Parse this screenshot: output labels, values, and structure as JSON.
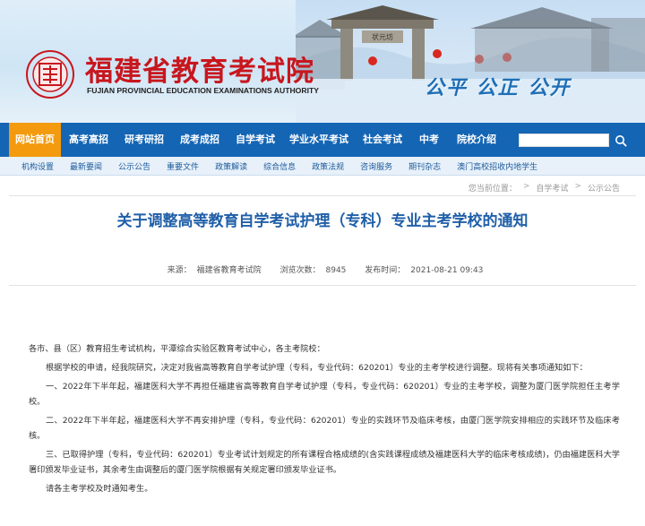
{
  "header": {
    "brand_cn": "福建省教育考试院",
    "brand_en": "FUJIAN PROVINCIAL EDUCATION EXAMINATIONS AUTHORITY",
    "slogan": "公平 公正 公开",
    "seal_text": "福建省教育考试院",
    "arch_plaque": "状元坊"
  },
  "nav": {
    "items": [
      "网站首页",
      "高考高招",
      "研考研招",
      "成考成招",
      "自学考试",
      "学业水平考试",
      "社会考试",
      "中考",
      "院校介绍"
    ],
    "active_index": 0,
    "search_placeholder": "",
    "search_icon": "search-icon"
  },
  "subnav": {
    "items": [
      "机构设置",
      "最新要闻",
      "公示公告",
      "重要文件",
      "政策解读",
      "综合信息",
      "政策法规",
      "咨询服务",
      "期刊杂志",
      "澳门高校招收内地学生"
    ]
  },
  "breadcrumb": {
    "prefix": "您当前位置：",
    "items": [
      "自学考试",
      "公示公告"
    ]
  },
  "article": {
    "title": "关于调整高等教育自学考试护理（专科）专业主考学校的通知",
    "source_label": "来源：",
    "source": "福建省教育考试院",
    "views_label": "浏览次数：",
    "views": "8945",
    "date_label": "发布时间：",
    "date": "2021-08-21 09:43",
    "paragraphs": [
      "各市、县（区）教育招生考试机构，平潭综合实验区教育考试中心，各主考院校：",
      "根据学校的申请，经我院研究，决定对我省高等教育自学考试护理（专科，专业代码：620201）专业的主考学校进行调整。现将有关事项通知如下：",
      "一、2022年下半年起，福建医科大学不再担任福建省高等教育自学考试护理（专科，专业代码：620201）专业的主考学校，调整为厦门医学院担任主考学校。",
      "二、2022年下半年起，福建医科大学不再安排护理（专科，专业代码：620201）专业的实践环节及临床考核，由厦门医学院安排相应的实践环节及临床考核。",
      "三、已取得护理（专科，专业代码：620201）专业考试计划规定的所有课程合格成绩的(含实践课程成绩及福建医科大学的临床考核成绩)，仍由福建医科大学署印颁发毕业证书，其余考生由调整后的厦门医学院根据有关规定署印颁发毕业证书。",
      "请各主考学校及时通知考生。"
    ]
  },
  "colors": {
    "brand_red": "#c8161d",
    "nav_blue": "#1465b4",
    "nav_active": "#f39a0f",
    "title_blue": "#1f5fa8",
    "slogan_blue": "#1f6fb6"
  }
}
